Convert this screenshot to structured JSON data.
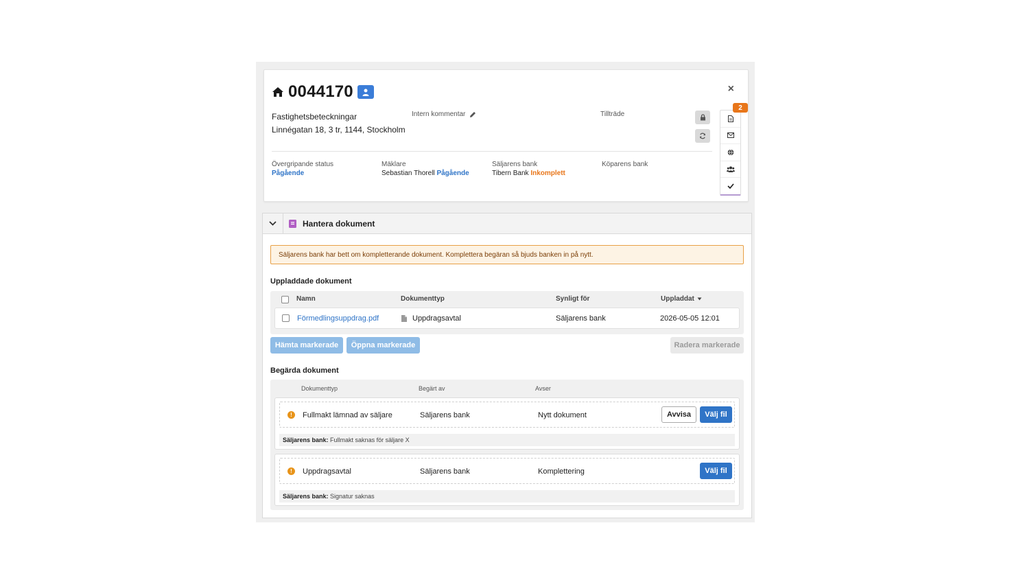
{
  "header": {
    "case_number": "0044170",
    "close_label": "×"
  },
  "property": {
    "label": "Fastighetsbeteckningar",
    "address": "Linnégatan 18, 3 tr, 1144, Stockholm"
  },
  "intern_comment_label": "Intern kommentar",
  "tilltrade_label": "Tillträde",
  "notification_count": "2",
  "status": {
    "overall_label": "Övergripande status",
    "overall_value": "Pågående",
    "broker_label": "Mäklare",
    "broker_name": "Sebastian Thorell",
    "broker_status": "Pågående",
    "seller_bank_label": "Säljarens bank",
    "seller_bank_name": "Tibern Bank",
    "seller_bank_status": "Inkomplett",
    "buyer_bank_label": "Köparens bank"
  },
  "documents": {
    "title": "Hantera dokument",
    "alert": "Säljarens bank har bett om kompletterande dokument. Komplettera begäran så bjuds banken in på nytt.",
    "uploaded_title": "Uppladdade dokument",
    "columns": {
      "name": "Namn",
      "type": "Dokumenttyp",
      "visible": "Synligt för",
      "uploaded": "Uppladdat"
    },
    "rows": [
      {
        "name": "Förmedlingsuppdrag.pdf",
        "type": "Uppdragsavtal",
        "visible": "Säljarens bank",
        "uploaded": "2026-05-05 12:01"
      }
    ],
    "btn_download": "Hämta markerade",
    "btn_open": "Öppna markerade",
    "btn_delete": "Radera markerade",
    "requested_title": "Begärda dokument",
    "req_columns": {
      "type": "Dokumenttyp",
      "requested_by": "Begärt av",
      "regarding": "Avser"
    },
    "requests": [
      {
        "type": "Fullmakt lämnad av säljare",
        "requested_by": "Säljarens bank",
        "regarding": "Nytt dokument",
        "reject_label": "Avvisa",
        "choose_label": "Välj fil",
        "note_who": "Säljarens bank:",
        "note_text": "Fullmakt saknas för säljare X"
      },
      {
        "type": "Uppdragsavtal",
        "requested_by": "Säljarens bank",
        "regarding": "Komplettering",
        "choose_label": "Välj fil",
        "note_who": "Säljarens bank:",
        "note_text": "Signatur saknas"
      }
    ]
  }
}
